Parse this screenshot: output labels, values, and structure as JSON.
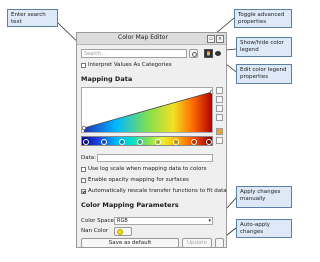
{
  "window": {
    "title": "Color Map Editor",
    "search_placeholder": "Search..."
  },
  "options": {
    "interpret_categories": "Interpret Values As Categories"
  },
  "mapping_data": {
    "heading": "Mapping Data",
    "data_label": "Data:",
    "log_scale": "Use log scale when mapping data to colors",
    "opacity_surfaces": "Enable opacity mapping for surfaces",
    "auto_rescale": "Automatically rescale transfer functions to fit data"
  },
  "color_mapping": {
    "heading": "Color Mapping Parameters",
    "color_space_label": "Color Space",
    "color_space_value": "RGB",
    "nan_color_label": "Nan Color",
    "nan_color": "#f4e000"
  },
  "buttons": {
    "save_default": "Save as default",
    "update": "Update"
  },
  "callouts": {
    "search": "Enter search text",
    "advanced": "Toggle advanced properties",
    "legend": "Show/hide color legend",
    "edit_legend": "Edit color legend properties",
    "apply": "Apply changes manually",
    "auto_apply": "Auto-apply changes"
  },
  "colors": {
    "callout_bg": "#dde9f6",
    "callout_border": "#5a7fa8"
  }
}
